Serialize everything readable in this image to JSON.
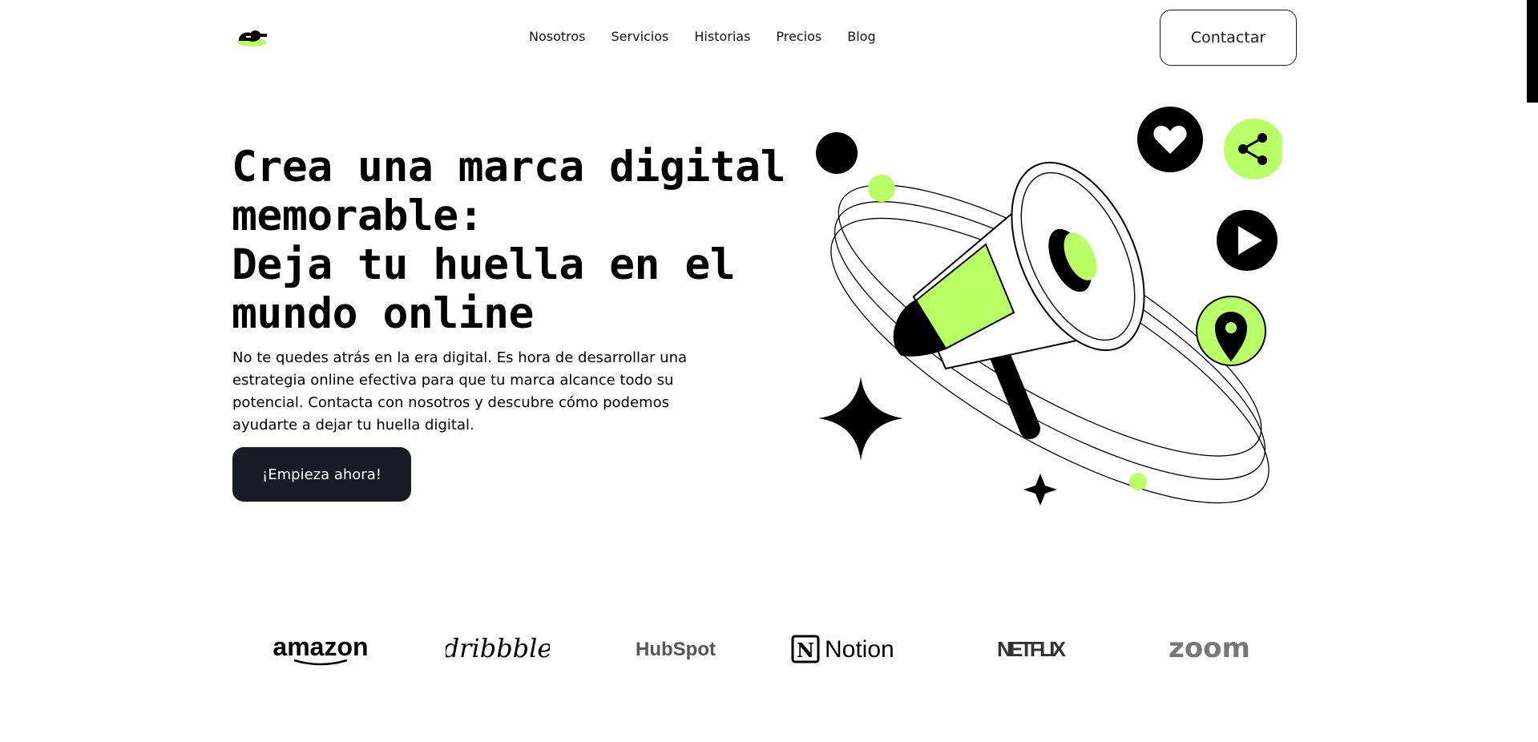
{
  "nav": {
    "items": [
      {
        "label": "Nosotros"
      },
      {
        "label": "Servicios"
      },
      {
        "label": "Historias"
      },
      {
        "label": "Precios"
      },
      {
        "label": "Blog"
      }
    ],
    "contact_label": "Contactar"
  },
  "hero": {
    "title_lines": [
      "Crea una marca digital",
      "memorable:",
      "Deja tu huella en el",
      "mundo online"
    ],
    "description": "No te quedes atrás en la era digital. Es hora de desarrollar una estrategia online efectiva para que tu marca alcance todo su potencial. Contacta con nosotros y descubre cómo podemos ayudarte a dejar tu huella digital.",
    "cta_label": "¡Empieza ahora!"
  },
  "brands": [
    "amazon",
    "dribbble",
    "HubSpot",
    "Notion",
    "NETFLIX",
    "zoom"
  ],
  "icons": {
    "logo": "logo-icon",
    "heart": "heart-icon",
    "share": "share-icon",
    "play": "play-icon",
    "location": "location-pin-icon",
    "megaphone": "megaphone-icon"
  },
  "colors": {
    "accent": "#B9FF66",
    "dark": "#191A23",
    "black": "#000000",
    "white": "#FFFFFF"
  }
}
